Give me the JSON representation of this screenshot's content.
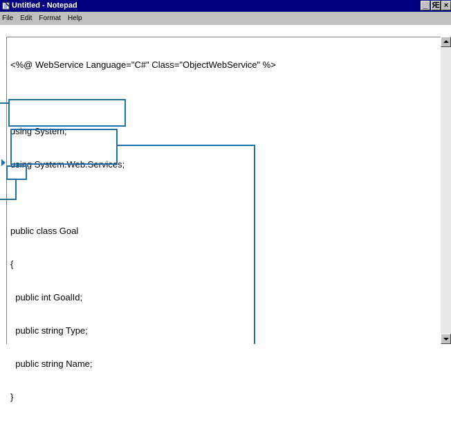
{
  "window": {
    "title": "Untitled - Notepad",
    "buttons": {
      "minimize": "_",
      "maximize": "Ԙ",
      "close": "×"
    }
  },
  "menu": [
    "File",
    "Edit",
    "Format",
    "Help"
  ],
  "editor": {
    "lines": [
      "<%@ WebService Language=\"C#\" Class=\"ObjectWebService\" %>",
      "",
      "using System;",
      "using System.Web.Services;",
      "",
      "public class Goal",
      "{",
      "  public int GoalId;",
      "  public string Type;",
      "  public string Name;",
      "}"
    ]
  },
  "colors": {
    "titlebar": "#000080",
    "chrome": "#c0c0c0",
    "callout": "#1f6fa8"
  }
}
